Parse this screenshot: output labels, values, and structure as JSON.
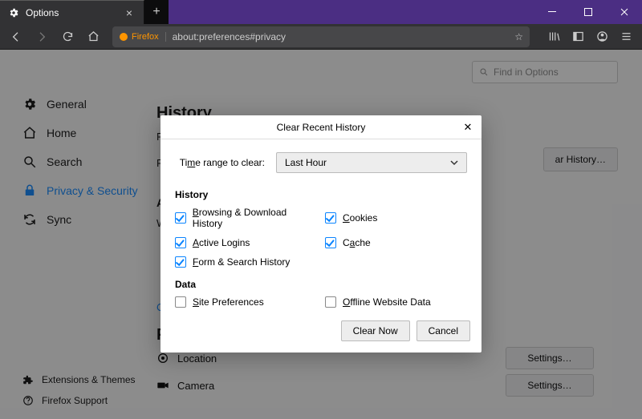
{
  "window": {
    "tab_title": "Options",
    "url_badge": "Firefox",
    "url": "about:preferences#privacy"
  },
  "search": {
    "placeholder": "Find in Options"
  },
  "sidebar": {
    "items": [
      {
        "label": "General"
      },
      {
        "label": "Home"
      },
      {
        "label": "Search"
      },
      {
        "label": "Privacy & Security"
      },
      {
        "label": "Sync"
      }
    ],
    "bottom": [
      {
        "label": "Extensions & Themes"
      },
      {
        "label": "Firefox Support"
      }
    ]
  },
  "main": {
    "history_heading": "History",
    "history_line1": "F",
    "history_line2": "F",
    "clear_history_btn": "ar History…",
    "subhead_a": "A",
    "subhead_w": "W",
    "link_text": "C",
    "permissions_heading": "Permissions",
    "perm_location": "Location",
    "perm_camera": "Camera",
    "settings_btn": "Settings…"
  },
  "dialog": {
    "title": "Clear Recent History",
    "range_label_pre": "Ti",
    "range_label_u": "m",
    "range_label_post": "e range to clear:",
    "range_value": "Last Hour",
    "section_history": "History",
    "section_data": "Data",
    "checks": {
      "browsing_u": "B",
      "browsing_post": "rowsing & Download History",
      "cookies_u": "C",
      "cookies_post": "ookies",
      "active_u": "A",
      "active_post": "ctive Logins",
      "cache_pre": "C",
      "cache_u": "a",
      "cache_post": "che",
      "form_u": "F",
      "form_post": "orm & Search History",
      "siteprefs_u": "S",
      "siteprefs_post": "ite Preferences",
      "offline_u": "O",
      "offline_post": "ffline Website Data"
    },
    "btn_clear": "Clear Now",
    "btn_cancel": "Cancel"
  }
}
